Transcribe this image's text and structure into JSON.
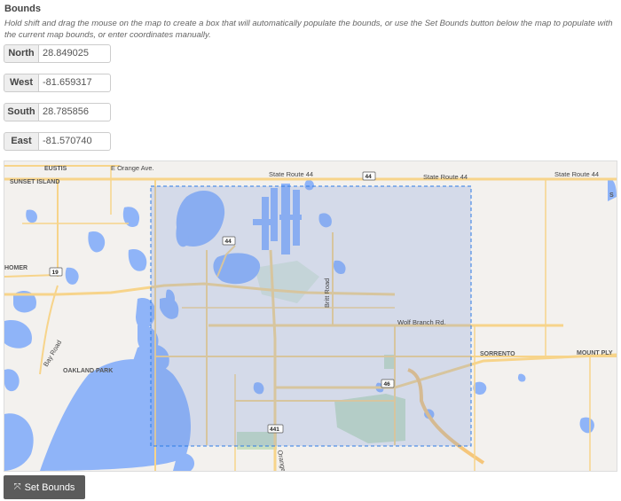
{
  "section": {
    "title": "Bounds",
    "help": "Hold shift and drag the mouse on the map to create a box that will automatically populate the bounds, or use the Set Bounds button below the map to populate with the current map bounds, or enter coordinates manually."
  },
  "fields": {
    "north": {
      "label": "North",
      "value": "28.849025"
    },
    "west": {
      "label": "West",
      "value": "-81.659317"
    },
    "south": {
      "label": "South",
      "value": "28.785856"
    },
    "east": {
      "label": "East",
      "value": "-81.570740"
    }
  },
  "map": {
    "labels": {
      "eustis": "EUSTIS",
      "orange_ave": "E Orange Ave.",
      "sunset_island": "SUNSET ISLAND",
      "sr44_a": "State Route 44",
      "sr44_b": "State Route 44",
      "sr44_c": "State Route 44",
      "britt_rd": "Britt Road",
      "wolf_branch": "Wolf Branch Rd.",
      "sorrento": "SORRENTO",
      "mount_ply": "MOUNT PLY",
      "bay_rd": "Bay Road",
      "oakland_park": "OAKLAND PARK",
      "homer": "HOMER",
      "orange": "Orange",
      "edge_s": "S"
    },
    "shields": {
      "s44_top": "44",
      "s44_mid": "44",
      "s19": "19",
      "s46": "46",
      "s441": "441"
    },
    "colors": {
      "water": "#8fb4f8",
      "land": "#f3f1ee",
      "road": "#f9d98d",
      "park": "#c9dfc0",
      "selection_fill": "rgba(120,150,220,0.25)",
      "selection_border": "#2c7be5"
    }
  },
  "button": {
    "label": "Set Bounds",
    "icon": "compress-arrows-icon"
  }
}
